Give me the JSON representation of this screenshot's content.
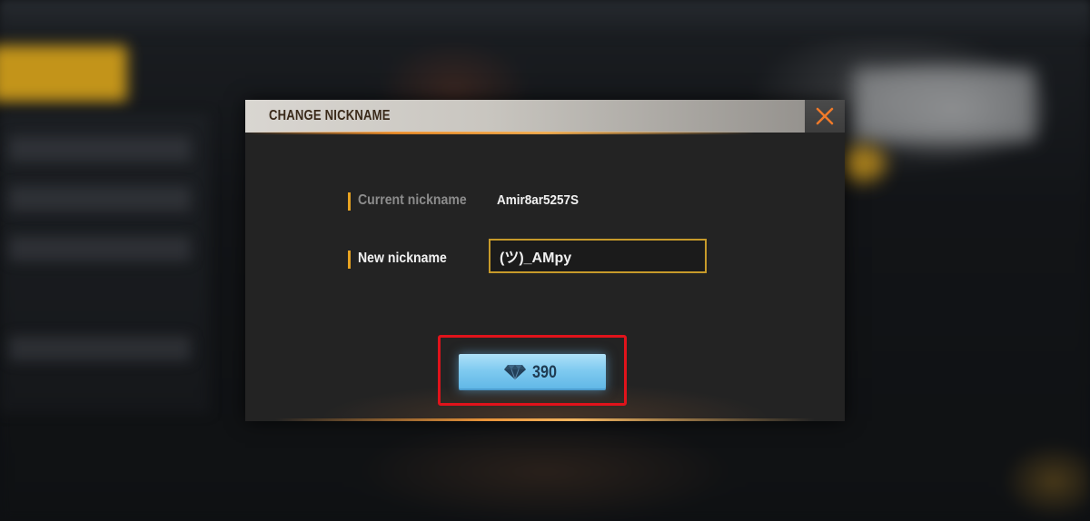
{
  "dialog": {
    "title": "CHANGE NICKNAME",
    "current_label": "Current nickname",
    "current_value": "Amir8ar5257S",
    "new_label": "New nickname",
    "new_value": "(ツ)_AMpy"
  },
  "purchase": {
    "price": "390",
    "currency_icon": "diamond-icon"
  },
  "colors": {
    "accent_gold": "#e7a321",
    "input_border": "#c79a2a",
    "button_blue": "#7fcaf0",
    "highlight_red": "#e0131b"
  }
}
